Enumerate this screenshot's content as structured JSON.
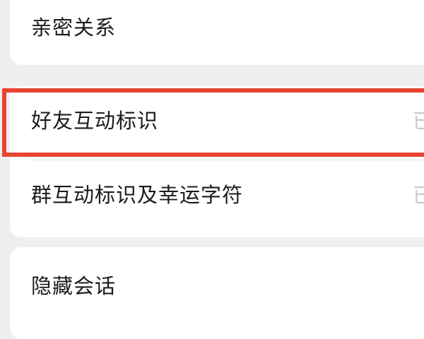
{
  "settings": {
    "group1": {
      "intimate": {
        "label": "亲密关系"
      }
    },
    "group2": {
      "friend_badge": {
        "label": "好友互动标识",
        "value": "已"
      },
      "group_badge": {
        "label": "群互动标识及幸运字符",
        "value": "已"
      }
    },
    "group3": {
      "hidden_chats": {
        "label": "隐藏会话"
      }
    }
  },
  "highlight": {
    "color": "#e8442f"
  }
}
